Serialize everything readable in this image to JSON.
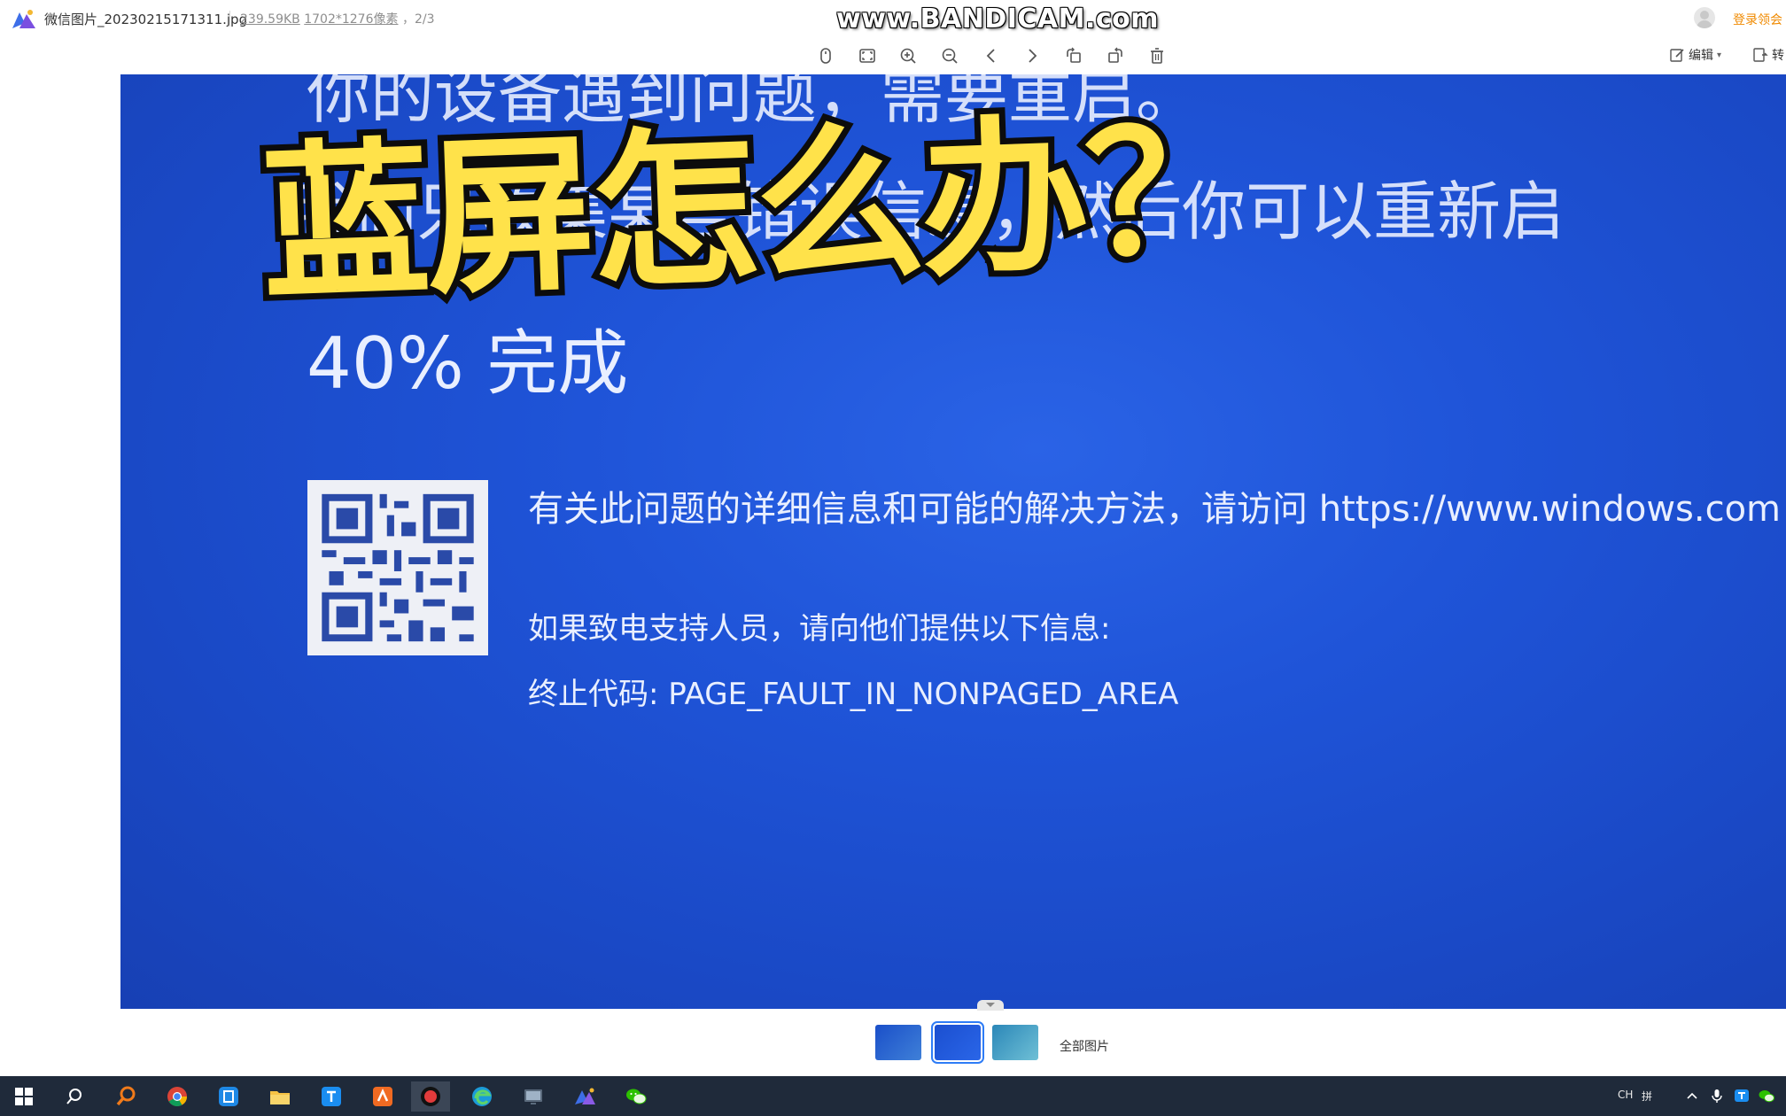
{
  "titlebar": {
    "file_name": "微信图片_20230215171311.jpg",
    "file_size": "239.59KB",
    "resolution": "1702*1276像素",
    "index": "2/3",
    "login_label": "登录领会"
  },
  "watermark": "www.BANDICAM.com",
  "toolbar": {
    "icons": [
      "mouse-icon",
      "fit-screen-icon",
      "zoom-in-icon",
      "zoom-out-icon",
      "prev-icon",
      "next-icon",
      "rotate-left-icon",
      "rotate-right-icon",
      "delete-icon"
    ],
    "edit_label": "编辑",
    "convert_label": "转"
  },
  "bsod": {
    "line1": "你的设备遇到问题，需要重启。",
    "line2": "我们只收集某些错误信息，然后你可以重新启",
    "progress": "40% 完成",
    "info": "有关此问题的详细信息和可能的解决方法，请访问 https://www.windows.com",
    "support": "如果致电支持人员，请向他们提供以下信息:",
    "stop_code": "终止代码: PAGE_FAULT_IN_NONPAGED_AREA",
    "background_color": "#1f54d8"
  },
  "overlay_title": "蓝屏怎么办？",
  "thumbnails": {
    "count": 3,
    "selected_index": 2,
    "all_images_label": "全部图片"
  },
  "taskbar": {
    "icons": [
      "windows-start-icon",
      "search-icon",
      "magnifier-app-icon",
      "chrome-icon",
      "app-blue-icon",
      "file-explorer-icon",
      "app-tencent-icon",
      "app-orange-icon",
      "bandicam-record-icon",
      "edge-icon",
      "app-screen-icon",
      "image-viewer-icon",
      "wechat-icon"
    ],
    "tray_ime": "CH",
    "tray_grid": "拼"
  }
}
